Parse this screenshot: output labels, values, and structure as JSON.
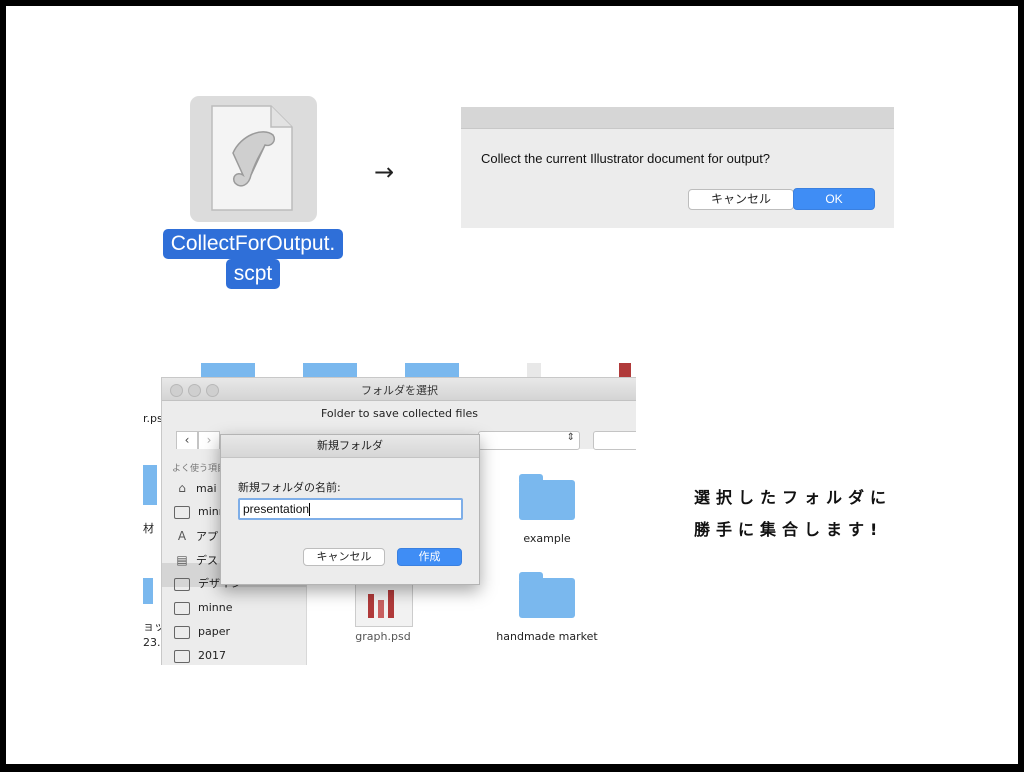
{
  "script_file": {
    "name_line1": "CollectForOutput.",
    "name_line2": "scpt",
    "icon": "applescript-document-icon"
  },
  "arrow": "→",
  "confirm_dialog": {
    "message": "Collect the current Illustrator document for output?",
    "cancel_label": "キャンセル",
    "ok_label": "OK"
  },
  "finder": {
    "window_title": "フォルダを選択",
    "prompt": "Folder to save collected files",
    "back": "‹",
    "forward": "›",
    "sidebar_heading": "よく使う項目",
    "sidebar_items": [
      "mai",
      "minn",
      "アプ",
      "デス",
      "デザイン",
      "minne",
      "paper",
      "2017"
    ],
    "left_cut_texts": [
      "r.ps",
      "材",
      "ョッ",
      "23."
    ],
    "files": [
      {
        "label": "example"
      },
      {
        "label": "graph.psd"
      },
      {
        "label": "handmade market"
      }
    ]
  },
  "new_folder_sheet": {
    "title": "新規フォルダ",
    "name_label": "新規フォルダの名前:",
    "name_value": "presentation",
    "cancel_label": "キャンセル",
    "create_label": "作成"
  },
  "caption": {
    "line1": "選択したフォルダに",
    "line2": "勝手に集合します!"
  },
  "colors": {
    "selection_blue": "#2f6fd8",
    "ok_blue": "#3f8df5",
    "folder_blue": "#7ab8ee"
  }
}
